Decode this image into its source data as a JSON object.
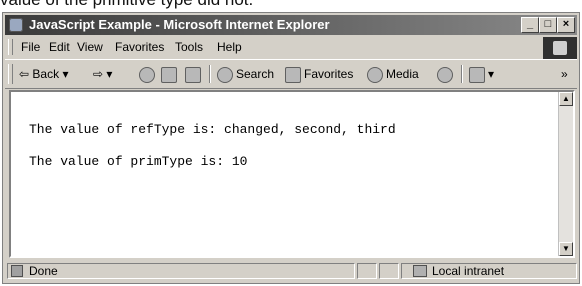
{
  "caption": "value of the primitive type did not.",
  "window": {
    "title": "JavaScript Example - Microsoft Internet Explorer",
    "controls": {
      "minimize": "_",
      "maximize": "□",
      "close": "×"
    }
  },
  "menu": [
    "File",
    "Edit",
    "View",
    "Favorites",
    "Tools",
    "Help"
  ],
  "toolbar": {
    "back": "Back",
    "back_arrow": "⇦",
    "back_dropdown": "▾",
    "forward_arrow": "⇨",
    "forward_dropdown": "▾",
    "search": "Search",
    "favorites": "Favorites",
    "media": "Media",
    "mail_dropdown": "▾",
    "overflow": "»"
  },
  "content": {
    "lines": [
      "The value of refType is: changed, second, third",
      "The value of primType is: 10"
    ]
  },
  "status": {
    "text": "Done",
    "zone": "Local intranet"
  },
  "icons": {
    "stop": "stop-icon",
    "refresh": "refresh-icon",
    "home": "home-icon",
    "search": "search-icon",
    "favorites": "favorites-icon",
    "media": "media-icon",
    "history": "history-icon",
    "mail": "mail-icon"
  }
}
